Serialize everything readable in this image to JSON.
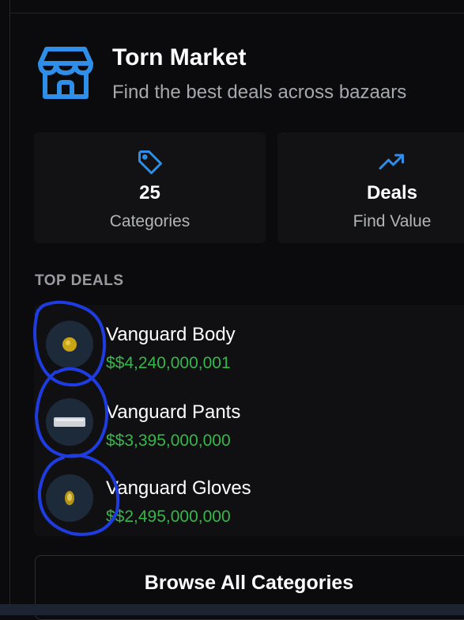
{
  "app": {
    "title": "Torn Market",
    "subtitle": "Find the best deals across bazaars",
    "icon": "store-icon",
    "accent": "#2f8fe8"
  },
  "stats": [
    {
      "icon": "tag-icon",
      "value": "25",
      "label": "Categories"
    },
    {
      "icon": "trending-up-icon",
      "value": "Deals",
      "label": "Find Value"
    }
  ],
  "top_deals": {
    "heading": "TOP DEALS",
    "price_color": "#35b84a",
    "items": [
      {
        "name": "Vanguard Body",
        "price": "$$4,240,000,001"
      },
      {
        "name": "Vanguard Pants",
        "price": "$$3,395,000,000"
      },
      {
        "name": "Vanguard Gloves",
        "price": "$$2,495,000,000"
      }
    ]
  },
  "browse": {
    "label": "Browse All Categories"
  },
  "annotation_color": "#1e3ce0"
}
